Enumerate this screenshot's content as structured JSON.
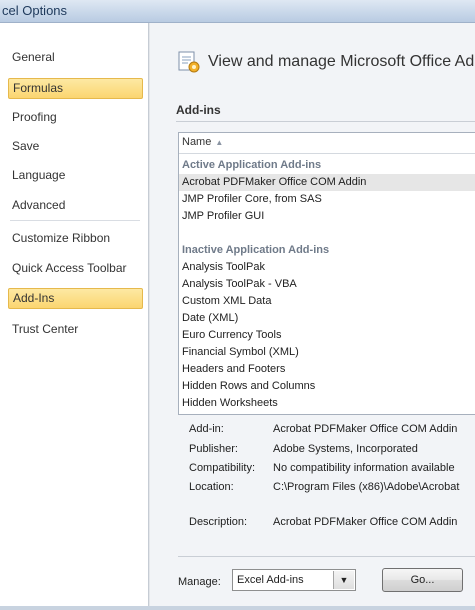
{
  "window": {
    "title": "cel Options"
  },
  "nav": {
    "items": [
      {
        "label": "General",
        "selected": false
      },
      {
        "label": "Formulas",
        "selected": true
      },
      {
        "label": "Proofing",
        "selected": false
      },
      {
        "label": "Save",
        "selected": false
      },
      {
        "label": "Language",
        "selected": false
      },
      {
        "label": "Advanced",
        "selected": false
      },
      {
        "label": "Customize Ribbon",
        "selected": false
      },
      {
        "label": "Quick Access Toolbar",
        "selected": false
      },
      {
        "label": "Add-Ins",
        "selected": true
      },
      {
        "label": "Trust Center",
        "selected": false
      }
    ]
  },
  "header": {
    "title": "View and manage Microsoft Office Ad",
    "icon": "addins-gear-icon"
  },
  "section": {
    "title": "Add-ins"
  },
  "list": {
    "column_name": "Name",
    "rows": [
      {
        "text": "Active Application Add-ins",
        "type": "group"
      },
      {
        "text": "Acrobat PDFMaker Office COM Addin",
        "type": "item",
        "selected": true
      },
      {
        "text": "JMP Profiler Core, from SAS",
        "type": "item"
      },
      {
        "text": "JMP Profiler GUI",
        "type": "item"
      },
      {
        "text": "",
        "type": "spacer"
      },
      {
        "text": "Inactive Application Add-ins",
        "type": "group"
      },
      {
        "text": "Analysis ToolPak",
        "type": "item"
      },
      {
        "text": "Analysis ToolPak - VBA",
        "type": "item"
      },
      {
        "text": "Custom XML Data",
        "type": "item"
      },
      {
        "text": "Date (XML)",
        "type": "item"
      },
      {
        "text": "Euro Currency Tools",
        "type": "item"
      },
      {
        "text": "Financial Symbol (XML)",
        "type": "item"
      },
      {
        "text": "Headers and Footers",
        "type": "item"
      },
      {
        "text": "Hidden Rows and Columns",
        "type": "item"
      },
      {
        "text": "Hidden Worksheets",
        "type": "item"
      }
    ]
  },
  "details": {
    "addin_label": "Add-in:",
    "addin_value": "Acrobat PDFMaker Office COM Addin",
    "publisher_label": "Publisher:",
    "publisher_value": "Adobe Systems, Incorporated",
    "compat_label": "Compatibility:",
    "compat_value": "No compatibility information available",
    "location_label": "Location:",
    "location_value": "C:\\Program Files (x86)\\Adobe\\Acrobat",
    "description_label": "Description:",
    "description_value": "Acrobat PDFMaker Office COM Addin"
  },
  "manage": {
    "label": "Manage:",
    "selected": "Excel Add-ins",
    "go_label": "Go..."
  }
}
